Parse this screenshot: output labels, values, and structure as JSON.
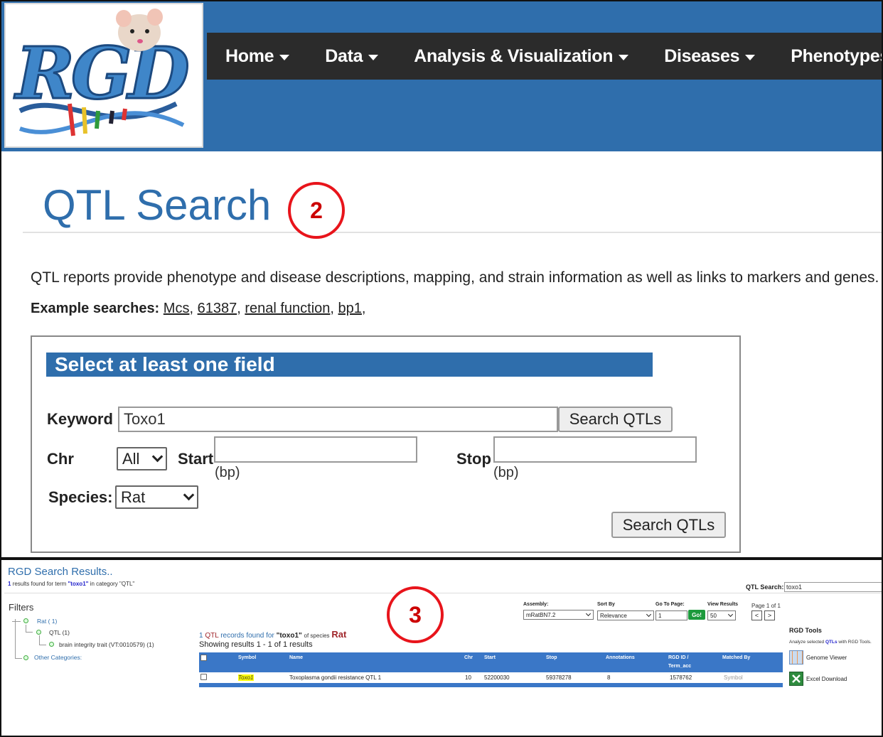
{
  "nav": {
    "items": [
      "Home",
      "Data",
      "Analysis & Visualization",
      "Diseases",
      "Phenotypes & Models"
    ]
  },
  "colors": {
    "brand_blue": "#2f6eac",
    "nav_bg": "#2b2b2b",
    "callout_red": "#e8141b",
    "table_header": "#3a77c7",
    "go_green": "#1c9a3c"
  },
  "page": {
    "title": "QTL Search",
    "description": "QTL reports provide phenotype and disease descriptions, mapping, and strain information as well as links to markers and genes.",
    "examples_label": "Example searches:",
    "examples": [
      "Mcs",
      "61387",
      "renal function",
      "bp1"
    ]
  },
  "callouts": {
    "top": "2",
    "bottom": "3"
  },
  "form": {
    "heading": "Select at least one field",
    "keyword_label": "Keyword",
    "keyword_value": "Toxo1",
    "search_button": "Search QTLs",
    "chr_label": "Chr",
    "chr_value": "All",
    "start_label": "Start",
    "stop_label": "Stop",
    "unit": "(bp)",
    "species_label": "Species:",
    "species_value": "Rat",
    "submit_button": "Search QTLs"
  },
  "results": {
    "title": "RGD Search Results..",
    "subtitle_count": "1",
    "subtitle_mid": "results found for term",
    "subtitle_term": "\"toxo1\"",
    "subtitle_end": "in category \"QTL\"",
    "qtl_search_label": "QTL Search:",
    "qtl_search_value": "toxo1",
    "filters_title": "Filters",
    "filter_rat": "Rat ( 1)",
    "filter_qtl": "QTL (1)",
    "filter_trait": "brain integrity trait (VT:0010579) (1)",
    "filter_other": "Other Categories:",
    "assembly_label": "Assembly:",
    "assembly_value": "mRatBN7.2",
    "sort_label": "Sort By",
    "sort_value": "Relevance",
    "goto_label": "Go To Page:",
    "goto_value": "1",
    "go_button": "Go!",
    "view_label": "View Results",
    "view_value": "50",
    "page_info": "Page 1 of 1",
    "prev": "<",
    "next": ">",
    "records_count": "1",
    "records_qtl": "QTL",
    "records_mid": "records found for",
    "records_term": "\"toxo1\"",
    "records_species_label": "of species",
    "records_species": "Rat",
    "showing": "Showing results 1 - 1 of 1 results",
    "columns": [
      "Symbol",
      "Name",
      "Chr",
      "Start",
      "Stop",
      "Annotations",
      "RGD ID /",
      "Term_acc",
      "Matched By"
    ],
    "row": {
      "symbol": "Toxo1",
      "name": "Toxoplasma gondii resistance QTL 1",
      "chr": "10",
      "start": "52200030",
      "stop": "59378278",
      "annotations": "8",
      "rgd_id": "1578762",
      "matched_by": "Symbol"
    },
    "tools_title": "RGD Tools",
    "tools_desc_1": "Analyze selected",
    "tools_desc_qtls": "QTLs",
    "tools_desc_2": "with RGD Tools.",
    "tool_genome_viewer": "Genome Viewer",
    "tool_excel": "Excel Download"
  }
}
